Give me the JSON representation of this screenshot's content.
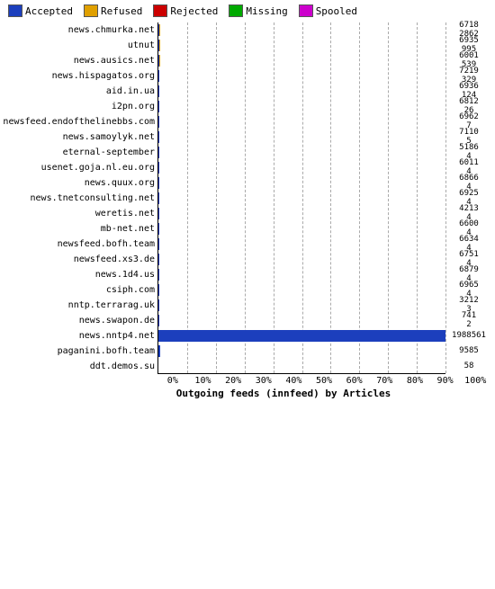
{
  "legend": {
    "items": [
      {
        "label": "Accepted",
        "color": "#1c3fbd",
        "name": "accepted"
      },
      {
        "label": "Refused",
        "color": "#e0a000",
        "name": "refused"
      },
      {
        "label": "Rejected",
        "color": "#cc0000",
        "name": "rejected"
      },
      {
        "label": "Missing",
        "color": "#00aa00",
        "name": "missing"
      },
      {
        "label": "Spooled",
        "color": "#cc00cc",
        "name": "spooled"
      }
    ]
  },
  "chart": {
    "title": "Outgoing feeds (innfeed) by Articles",
    "x_labels": [
      "0%",
      "10%",
      "20%",
      "30%",
      "40%",
      "50%",
      "60%",
      "70%",
      "80%",
      "90%",
      "100%"
    ],
    "rows": [
      {
        "label": "news.chmurka.net",
        "accepted": 6718,
        "refused": 2862,
        "rejected": 0,
        "missing": 0,
        "spooled": 0,
        "total": 9580
      },
      {
        "label": "utnut",
        "accepted": 6935,
        "refused": 995,
        "rejected": 0,
        "missing": 0,
        "spooled": 0,
        "total": 7930
      },
      {
        "label": "news.ausics.net",
        "accepted": 6001,
        "refused": 539,
        "rejected": 0,
        "missing": 0,
        "spooled": 0,
        "total": 6540
      },
      {
        "label": "news.hispagatos.org",
        "accepted": 7219,
        "refused": 329,
        "rejected": 0,
        "missing": 0,
        "spooled": 0,
        "total": 7548
      },
      {
        "label": "aid.in.ua",
        "accepted": 6936,
        "refused": 124,
        "rejected": 0,
        "missing": 0,
        "spooled": 0,
        "total": 7060
      },
      {
        "label": "i2pn.org",
        "accepted": 6812,
        "refused": 26,
        "rejected": 0,
        "missing": 0,
        "spooled": 0,
        "total": 6838
      },
      {
        "label": "newsfeed.endofthelinebbs.com",
        "accepted": 6962,
        "refused": 7,
        "rejected": 0,
        "missing": 0,
        "spooled": 0,
        "total": 6969
      },
      {
        "label": "news.samoylyk.net",
        "accepted": 7110,
        "refused": 5,
        "rejected": 0,
        "missing": 0,
        "spooled": 0,
        "total": 7115
      },
      {
        "label": "eternal-september",
        "accepted": 5186,
        "refused": 4,
        "rejected": 0,
        "missing": 0,
        "spooled": 0,
        "total": 5190
      },
      {
        "label": "usenet.goja.nl.eu.org",
        "accepted": 6011,
        "refused": 4,
        "rejected": 0,
        "missing": 0,
        "spooled": 0,
        "total": 6015
      },
      {
        "label": "news.quux.org",
        "accepted": 6866,
        "refused": 4,
        "rejected": 0,
        "missing": 0,
        "spooled": 0,
        "total": 6870
      },
      {
        "label": "news.tnetconsulting.net",
        "accepted": 6925,
        "refused": 4,
        "rejected": 0,
        "missing": 0,
        "spooled": 0,
        "total": 6929
      },
      {
        "label": "weretis.net",
        "accepted": 4213,
        "refused": 4,
        "rejected": 0,
        "missing": 0,
        "spooled": 0,
        "total": 4217
      },
      {
        "label": "mb-net.net",
        "accepted": 6600,
        "refused": 4,
        "rejected": 0,
        "missing": 0,
        "spooled": 0,
        "total": 6604
      },
      {
        "label": "newsfeed.bofh.team",
        "accepted": 6634,
        "refused": 4,
        "rejected": 0,
        "missing": 0,
        "spooled": 0,
        "total": 6638
      },
      {
        "label": "newsfeed.xs3.de",
        "accepted": 6751,
        "refused": 4,
        "rejected": 0,
        "missing": 0,
        "spooled": 0,
        "total": 6755
      },
      {
        "label": "news.1d4.us",
        "accepted": 6879,
        "refused": 4,
        "rejected": 0,
        "missing": 0,
        "spooled": 0,
        "total": 6883
      },
      {
        "label": "csiph.com",
        "accepted": 6965,
        "refused": 4,
        "rejected": 0,
        "missing": 0,
        "spooled": 0,
        "total": 6969
      },
      {
        "label": "nntp.terrarag.uk",
        "accepted": 3212,
        "refused": 3,
        "rejected": 0,
        "missing": 0,
        "spooled": 0,
        "total": 3215
      },
      {
        "label": "news.swapon.de",
        "accepted": 741,
        "refused": 2,
        "rejected": 0,
        "missing": 0,
        "spooled": 0,
        "total": 743
      },
      {
        "label": "news.nntp4.net",
        "accepted": 1988561,
        "refused": 0,
        "rejected": 0,
        "missing": 0,
        "spooled": 0,
        "total": 1988561
      },
      {
        "label": "paganini.bofh.team",
        "accepted": 9585,
        "refused": 0,
        "rejected": 0,
        "missing": 0,
        "spooled": 0,
        "total": 9585
      },
      {
        "label": "ddt.demos.su",
        "accepted": 58,
        "refused": 0,
        "rejected": 0,
        "missing": 0,
        "spooled": 0,
        "total": 58
      }
    ]
  },
  "colors": {
    "accepted": "#1c3fbd",
    "refused": "#e0a000",
    "rejected": "#cc0000",
    "missing": "#00aa00",
    "spooled": "#cc00cc",
    "grid": "#cccccc",
    "border": "#000000"
  }
}
